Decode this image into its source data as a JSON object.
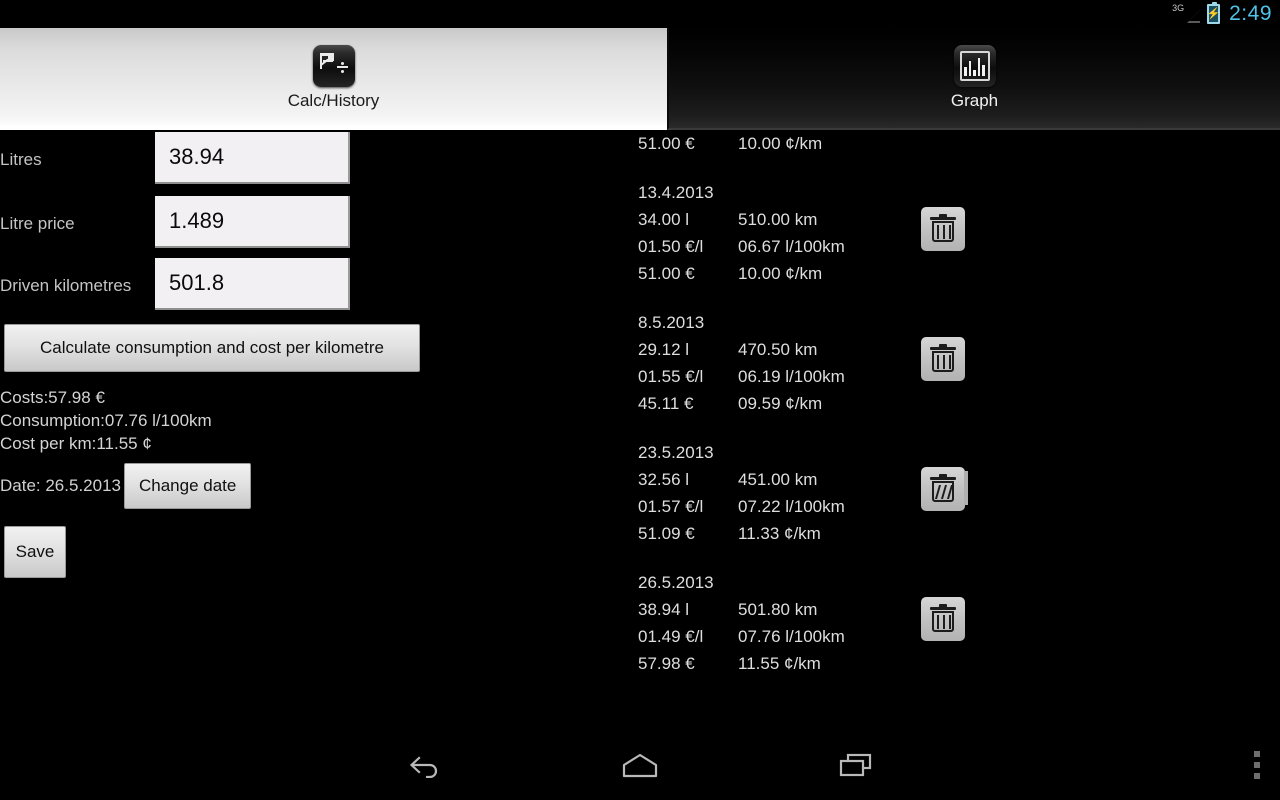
{
  "status_bar": {
    "network": "3G",
    "battery_icon": "battery-charging-icon",
    "clock": "2:49"
  },
  "tabs": [
    {
      "label": "Calc/History",
      "icon": "calculator-icon",
      "active": true
    },
    {
      "label": "Graph",
      "icon": "bar-chart-icon",
      "active": false
    }
  ],
  "form": {
    "fields": [
      {
        "label": "Litres",
        "value": "38.94",
        "name": "litres"
      },
      {
        "label": "Litre price",
        "value": "1.489",
        "name": "litre-price"
      },
      {
        "label": "Driven kilometres",
        "value": "501.8",
        "name": "driven-kilometres"
      }
    ],
    "calculate_label": "Calculate consumption and cost per kilometre",
    "results": {
      "costs": "Costs:57.98 €",
      "consumption": "Consumption:07.76 l/100km",
      "cost_per_km": "Cost per km:11.55 ¢"
    },
    "date_label": "Date: 26.5.2013",
    "change_date_label": "Change date",
    "save_label": "Save"
  },
  "history": {
    "partial_top_entry": {
      "cost": "51.00 €",
      "cost_per_km": "10.00 ¢/km"
    },
    "entries": [
      {
        "date": "13.4.2013",
        "litres": "34.00 l",
        "kilometres": "510.00 km",
        "litre_price": "01.50 €/l",
        "consumption": "06.67 l/100km",
        "cost": "51.00 €",
        "cost_per_km": "10.00 ¢/km",
        "delete_icon": "trash-icon",
        "glitched": false
      },
      {
        "date": "8.5.2013",
        "litres": "29.12 l",
        "kilometres": "470.50 km",
        "litre_price": "01.55 €/l",
        "consumption": "06.19 l/100km",
        "cost": "45.11 €",
        "cost_per_km": "09.59 ¢/km",
        "delete_icon": "trash-icon",
        "glitched": false
      },
      {
        "date": "23.5.2013",
        "litres": "32.56 l",
        "kilometres": "451.00 km",
        "litre_price": "01.57 €/l",
        "consumption": "07.22 l/100km",
        "cost": "51.09 €",
        "cost_per_km": "11.33 ¢/km",
        "delete_icon": "trash-icon",
        "glitched": true
      },
      {
        "date": "26.5.2013",
        "litres": "38.94 l",
        "kilometres": "501.80 km",
        "litre_price": "01.49 €/l",
        "consumption": "07.76 l/100km",
        "cost": "57.98 €",
        "cost_per_km": "11.55 ¢/km",
        "delete_icon": "trash-icon",
        "glitched": false
      }
    ]
  },
  "navigation": {
    "back": "back-icon",
    "home": "home-icon",
    "recents": "recent-apps-icon",
    "overflow": "overflow-menu-icon"
  },
  "colors": {
    "background": "#000000",
    "accent_clock": "#4fc3e8",
    "input_background": "#f2f0f2",
    "button_face": "#e2e2e2",
    "text_primary": "#dedede"
  }
}
